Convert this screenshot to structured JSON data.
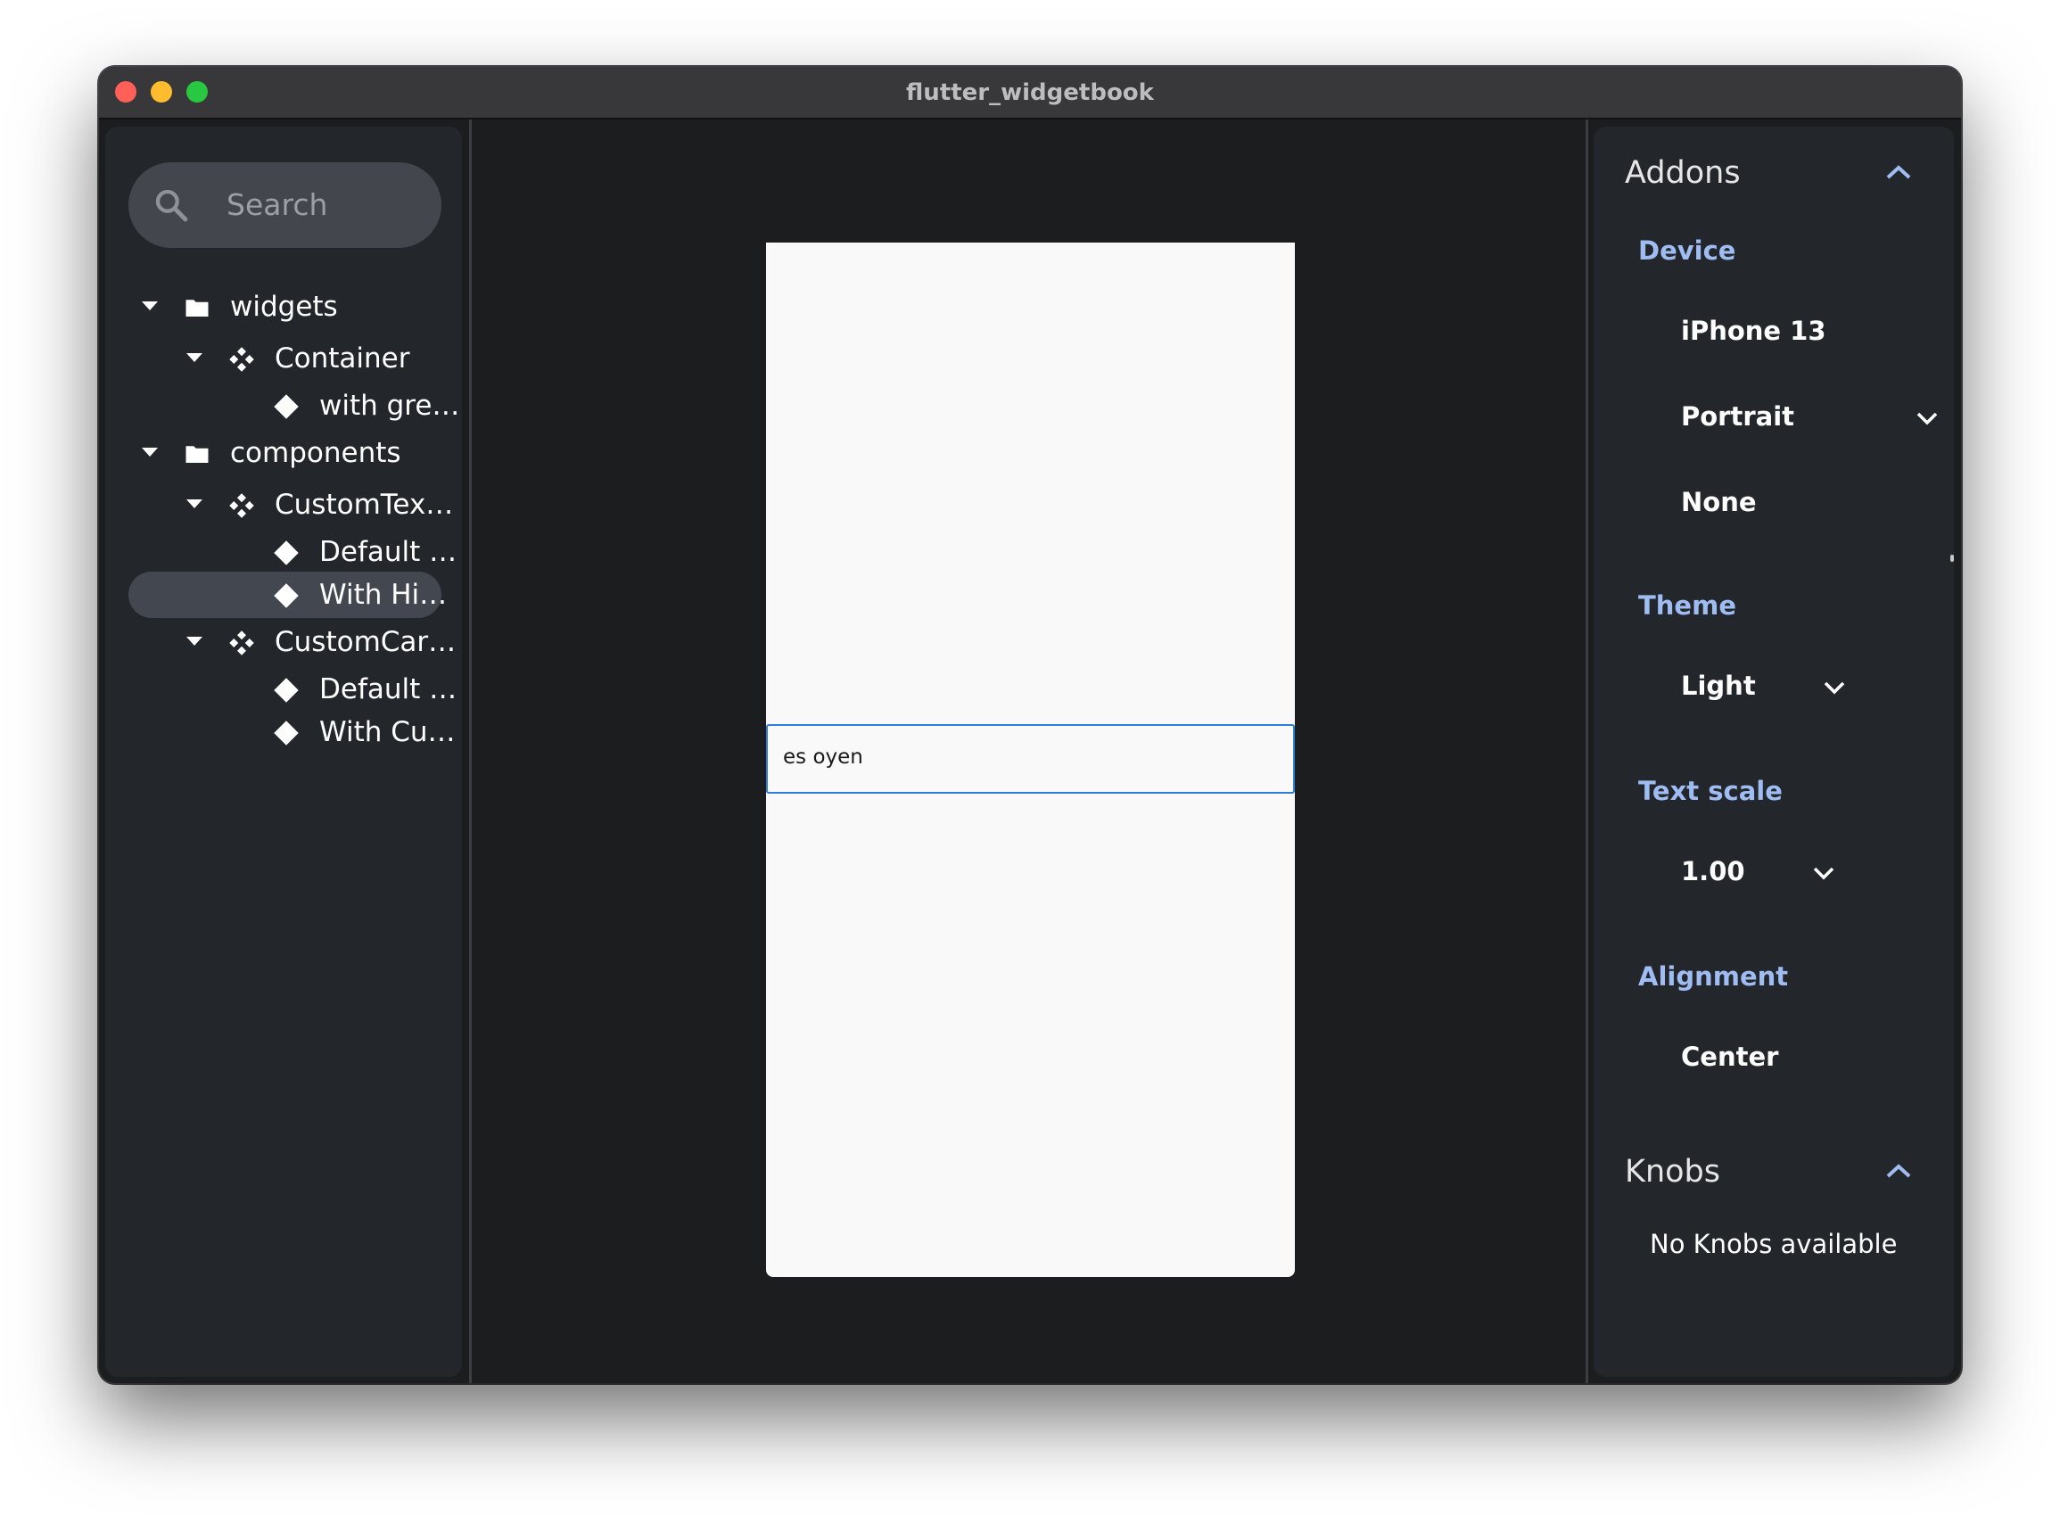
{
  "window": {
    "title": "flutter_widgetbook"
  },
  "search": {
    "placeholder": "Search"
  },
  "tree": [
    {
      "label": "widgets",
      "kind": "folder",
      "expanded": true
    },
    {
      "label": "Container",
      "kind": "component",
      "expanded": true
    },
    {
      "label": "with gre…",
      "kind": "use-case"
    },
    {
      "label": "components",
      "kind": "folder",
      "expanded": true
    },
    {
      "label": "CustomTex…",
      "kind": "component",
      "expanded": true
    },
    {
      "label": "Default …",
      "kind": "use-case"
    },
    {
      "label": "With Hi…",
      "kind": "use-case",
      "selected": true
    },
    {
      "label": "CustomCar…",
      "kind": "component",
      "expanded": true
    },
    {
      "label": "Default …",
      "kind": "use-case"
    },
    {
      "label": "With Cu…",
      "kind": "use-case"
    }
  ],
  "preview": {
    "text_field_value": "es oyen"
  },
  "addons": {
    "title": "Addons",
    "device": {
      "label": "Device",
      "model": "iPhone 13",
      "orientation": "Portrait",
      "frame": "None"
    },
    "theme": {
      "label": "Theme",
      "value": "Light"
    },
    "text_scale": {
      "label": "Text scale",
      "value": "1.00"
    },
    "alignment": {
      "label": "Alignment",
      "value": "Center"
    }
  },
  "knobs": {
    "title": "Knobs",
    "empty_text": "No Knobs available"
  },
  "colors": {
    "accent_label": "#9fbdf2",
    "focus_border": "#2f7dd6",
    "selection": "#43474f"
  }
}
